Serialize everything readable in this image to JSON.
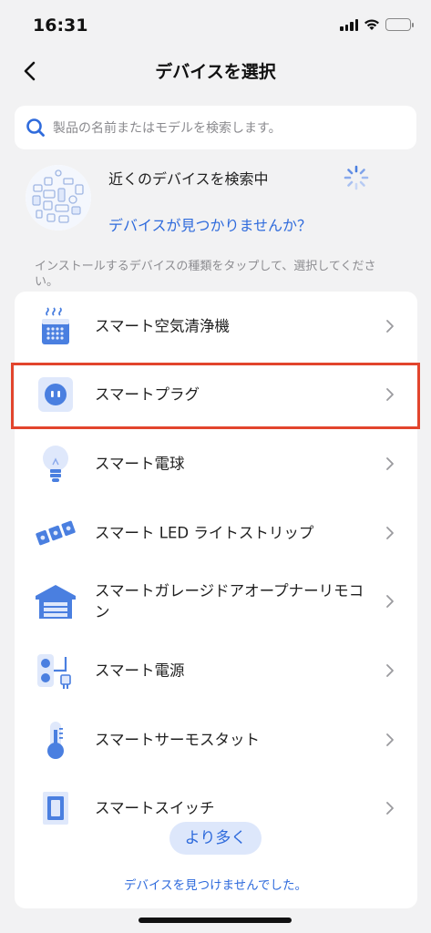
{
  "status_bar": {
    "time": "16:31",
    "icons": [
      "signal-icon",
      "wifi-icon",
      "battery-icon"
    ]
  },
  "nav": {
    "title": "デバイスを選択",
    "back_icon": "chevron-left-icon"
  },
  "search": {
    "placeholder": "製品の名前またはモデルを検索します。",
    "icon": "search-icon"
  },
  "nearby": {
    "title": "近くのデバイスを検索中",
    "link": "デバイスが見つかりませんか？",
    "spinner_icon": "loading-spinner-icon"
  },
  "hint": "インストールするデバイスの種類をタップして、選択してください。",
  "devices": [
    {
      "label": "スマート空気清浄機",
      "icon": "air-purifier-icon"
    },
    {
      "label": "スマートプラグ",
      "icon": "smart-plug-icon",
      "highlighted": true
    },
    {
      "label": "スマート電球",
      "icon": "light-bulb-icon"
    },
    {
      "label": "スマート LED ライトストリップ",
      "icon": "led-strip-icon"
    },
    {
      "label": "スマートガレージドアオープナーリモコン",
      "icon": "garage-door-icon"
    },
    {
      "label": "スマート電源",
      "icon": "power-strip-icon"
    },
    {
      "label": "スマートサーモスタット",
      "icon": "thermostat-icon"
    },
    {
      "label": "スマートスイッチ",
      "icon": "switch-icon"
    }
  ],
  "more_button": "より多く",
  "not_found_link": "デバイスを見つけませんでした。",
  "colors": {
    "accent": "#2f6bdc",
    "highlight": "#e2452d",
    "icon_blue": "#4a7fe0",
    "icon_light": "#dfe8fb"
  }
}
